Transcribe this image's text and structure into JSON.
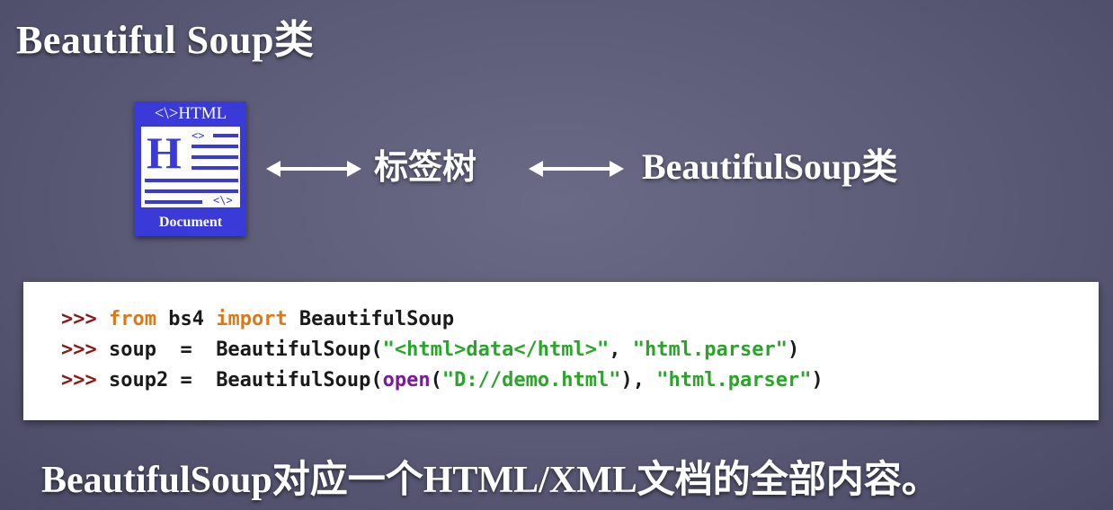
{
  "slide": {
    "title": "Beautiful Soup类",
    "icon": {
      "header": "<\\>HTML",
      "big_letter": "H",
      "small_tag_top": "<>",
      "small_tag_bottom": "<\\>",
      "footer": "Document",
      "color": "#3a3ad8"
    },
    "tag_tree_label": "标签树",
    "beautifulsoup_class_label": "BeautifulSoup类",
    "code": {
      "lines": [
        [
          {
            "cls": "prompt",
            "text": ">>> "
          },
          {
            "cls": "kw",
            "text": "from"
          },
          {
            "cls": "plain",
            "text": " bs4 "
          },
          {
            "cls": "kw",
            "text": "import"
          },
          {
            "cls": "plain",
            "text": " BeautifulSoup"
          }
        ],
        [
          {
            "cls": "prompt",
            "text": ">>> "
          },
          {
            "cls": "plain",
            "text": "soup  =  BeautifulSoup("
          },
          {
            "cls": "str",
            "text": "\"<html>data</html>\""
          },
          {
            "cls": "plain",
            "text": ", "
          },
          {
            "cls": "str",
            "text": "\"html.parser\""
          },
          {
            "cls": "plain",
            "text": ")"
          }
        ],
        [
          {
            "cls": "prompt",
            "text": ">>> "
          },
          {
            "cls": "plain",
            "text": "soup2 =  BeautifulSoup("
          },
          {
            "cls": "bi",
            "text": "open"
          },
          {
            "cls": "plain",
            "text": "("
          },
          {
            "cls": "str",
            "text": "\"D://demo.html\""
          },
          {
            "cls": "plain",
            "text": "), "
          },
          {
            "cls": "str",
            "text": "\"html.parser\""
          },
          {
            "cls": "plain",
            "text": ")"
          }
        ]
      ],
      "colors": {
        "prompt": "#8a1a1a",
        "keyword": "#d97a1a",
        "string": "#2aa52a",
        "builtin": "#7a1a9a"
      }
    },
    "caption": "BeautifulSoup对应一个HTML/XML文档的全部内容。",
    "background_color": "#5a5a76"
  }
}
